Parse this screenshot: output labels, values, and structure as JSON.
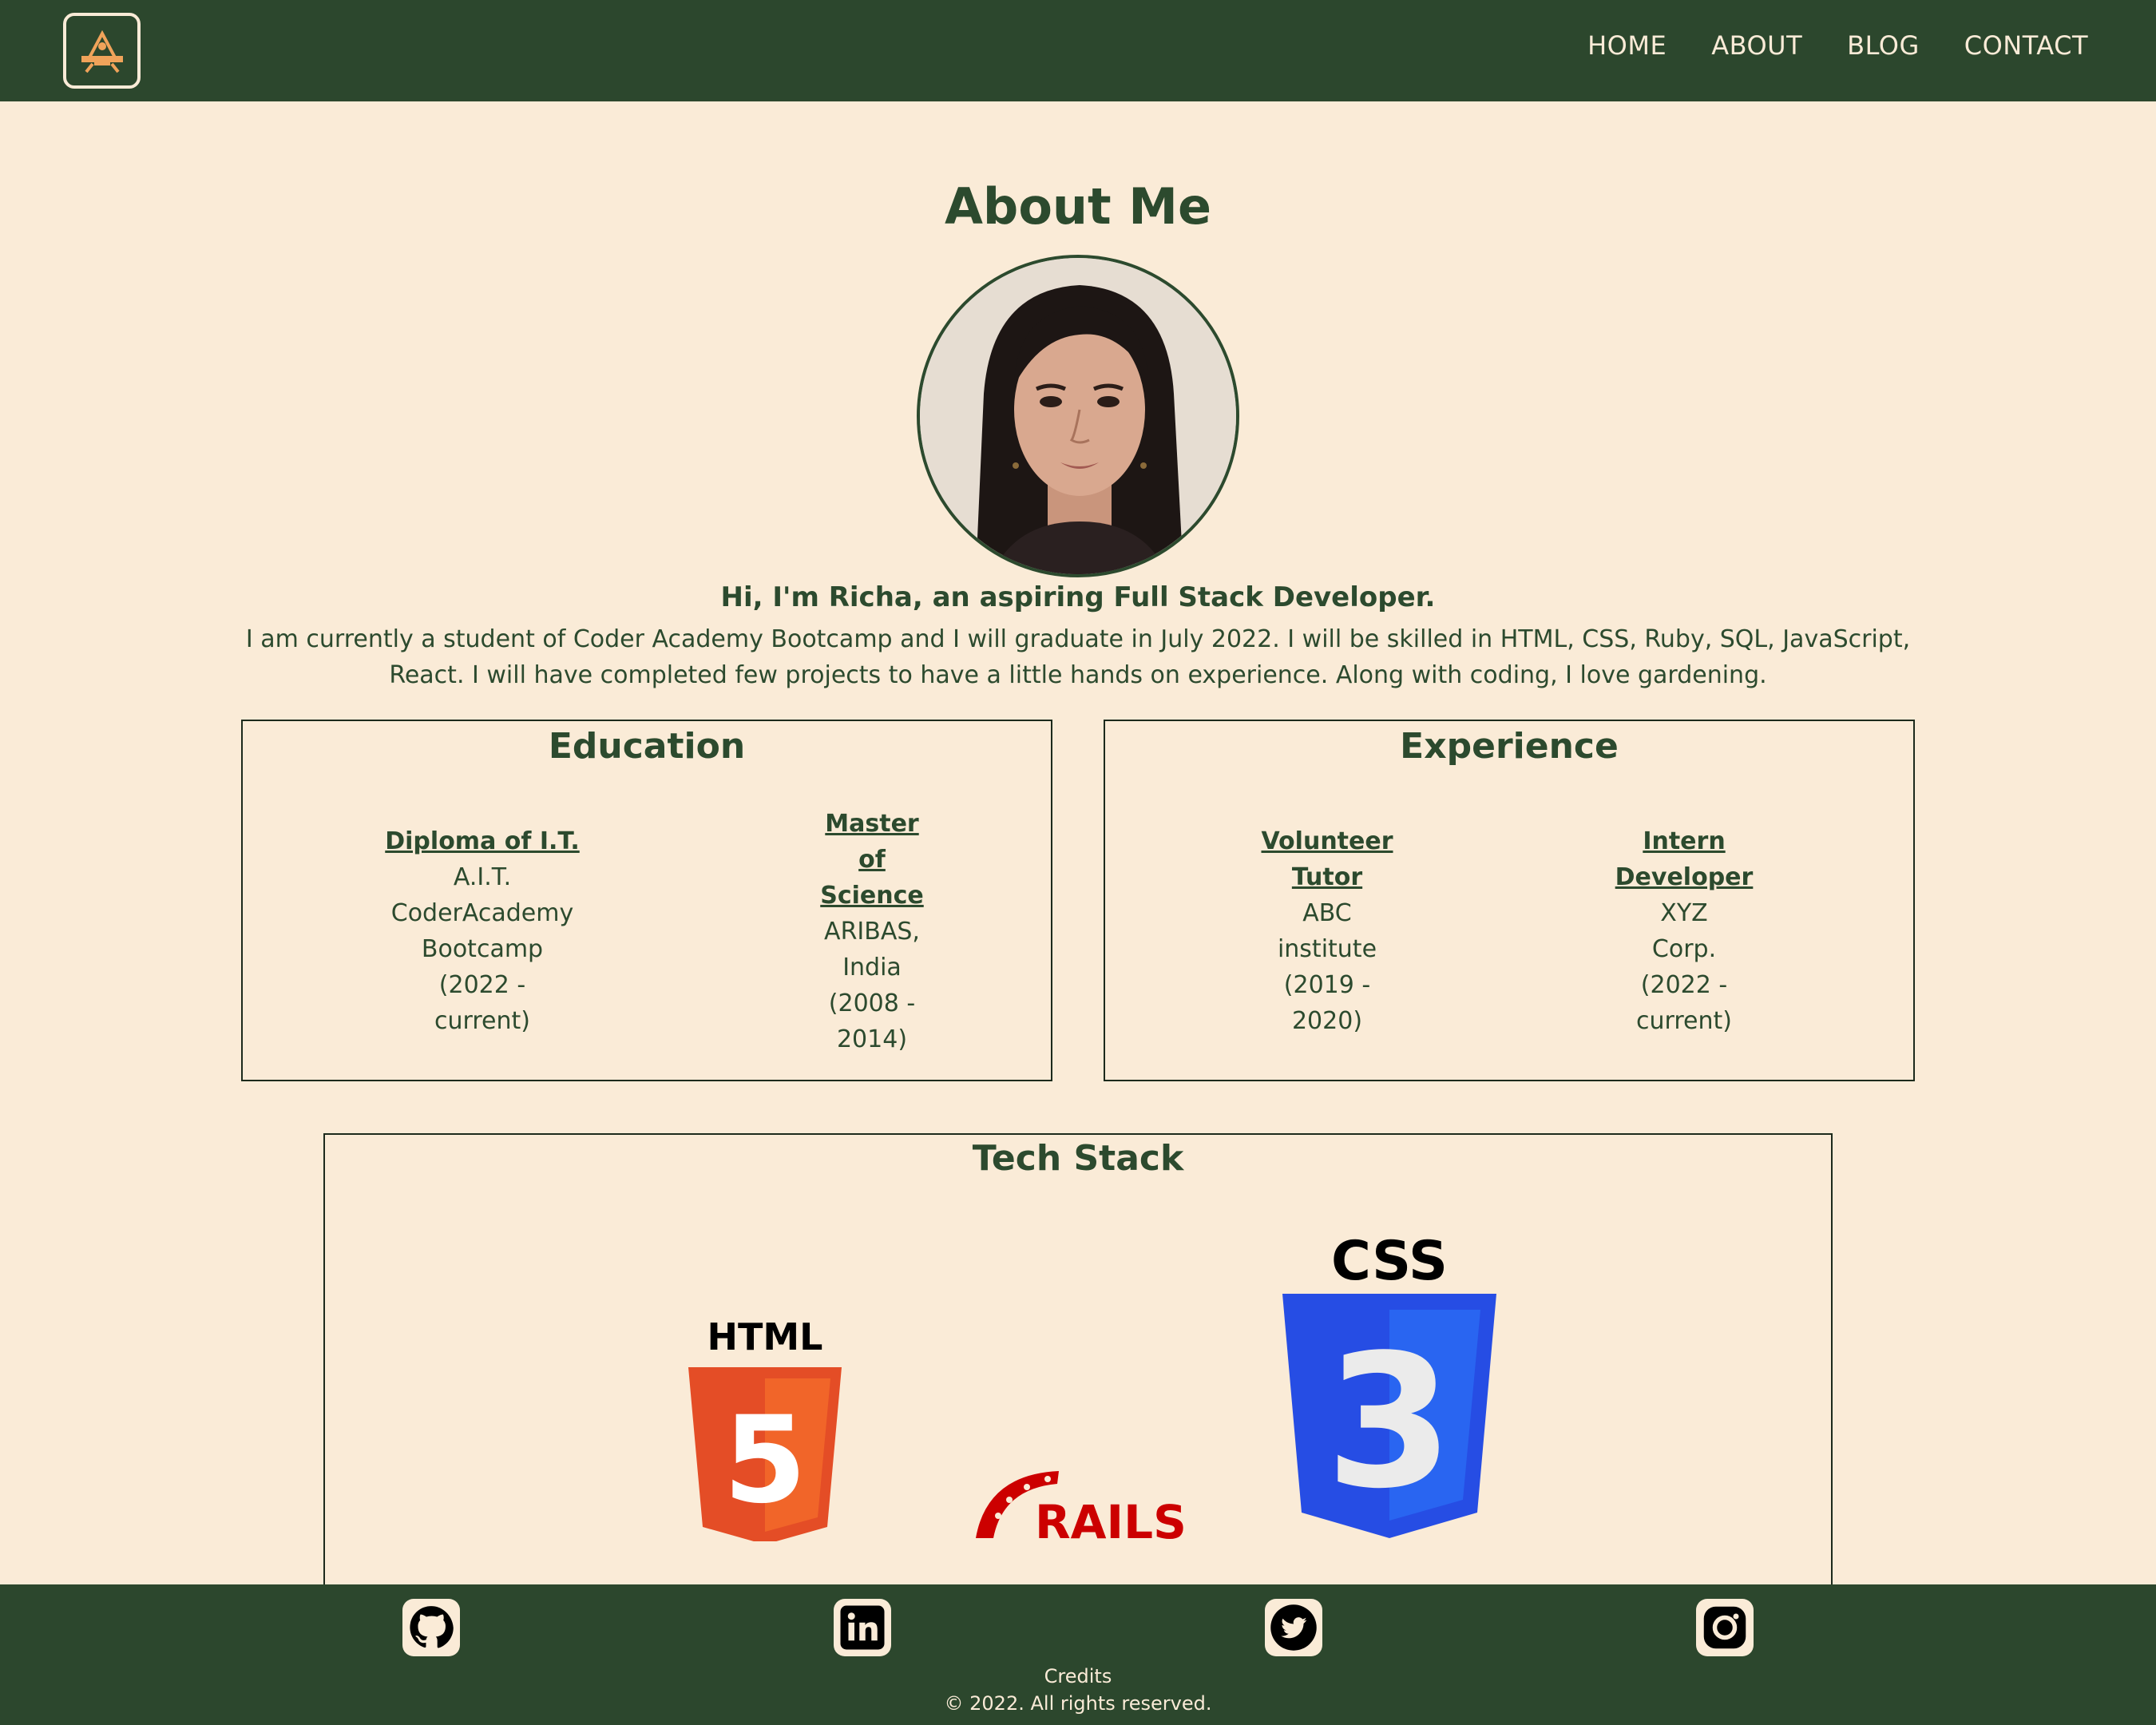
{
  "nav": {
    "links": [
      "HOME",
      "ABOUT",
      "BLOG",
      "CONTACT"
    ]
  },
  "about": {
    "title": "About Me",
    "intro_heading": "Hi, I'm Richa, an aspiring Full Stack Developer.",
    "intro_text": "I am currently a student of Coder Academy Bootcamp and I will graduate in July 2022. I will be skilled in HTML, CSS, Ruby, SQL, JavaScript, React. I will have completed few projects to have a little hands on experience. Along with coding, I love gardening."
  },
  "education": {
    "title": "Education",
    "items": [
      {
        "title": "Diploma of I.T.",
        "lines": [
          "A.I.T.",
          "CoderAcademy",
          "Bootcamp",
          "(2022 -",
          "current)"
        ]
      },
      {
        "title_lines": [
          "Master",
          "of",
          "Science"
        ],
        "lines": [
          "ARIBAS,",
          "India",
          "(2008 -",
          "2014)"
        ]
      }
    ]
  },
  "experience": {
    "title": "Experience",
    "items": [
      {
        "title_lines": [
          "Volunteer",
          "Tutor"
        ],
        "lines": [
          "ABC",
          "institute",
          "(2019 -",
          "2020)"
        ]
      },
      {
        "title_lines": [
          "Intern",
          "Developer"
        ],
        "lines": [
          "XYZ",
          "Corp.",
          "(2022 -",
          "current)"
        ]
      }
    ]
  },
  "tech_stack": {
    "title": "Tech Stack",
    "html_label": "HTML",
    "css_label": "CSS",
    "rails_label": "RAILS",
    "html_number": "5",
    "css_number": "3"
  },
  "footer": {
    "social_icons": [
      "github-icon",
      "linkedin-icon",
      "twitter-icon",
      "instagram-icon"
    ],
    "credits": "Credits",
    "copyright": "© 2022. All rights reserved."
  },
  "colors": {
    "background": "#faebd7",
    "nav_bg": "#2c472d",
    "text": "#2c4a2e",
    "html_orange": "#e44d26",
    "css_blue": "#264de4",
    "rails_red": "#cc0000",
    "logo_orange": "#f0a35a"
  }
}
